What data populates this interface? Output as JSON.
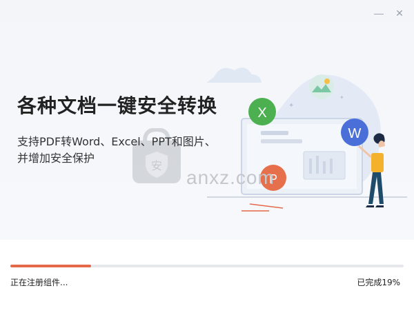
{
  "window": {
    "minimize_icon": "minimize-icon",
    "close_icon": "close-icon"
  },
  "hero": {
    "title": "各种文档一键安全转换",
    "subtitle": "支持PDF转Word、Excel、PPT和图片、并增加安全保护"
  },
  "illustration": {
    "badge_excel": "X",
    "badge_word": "W",
    "badge_ppt": "P"
  },
  "watermark": {
    "text": "anxz.com",
    "logo_char": "安"
  },
  "install": {
    "status_text": "正在注册组件...",
    "progress_text": "已完成19%",
    "progress_value": 0.19
  },
  "colors": {
    "accent": "#e4684a",
    "excel": "#4caf50",
    "word": "#4a6fd8",
    "ppt": "#e5704b"
  }
}
